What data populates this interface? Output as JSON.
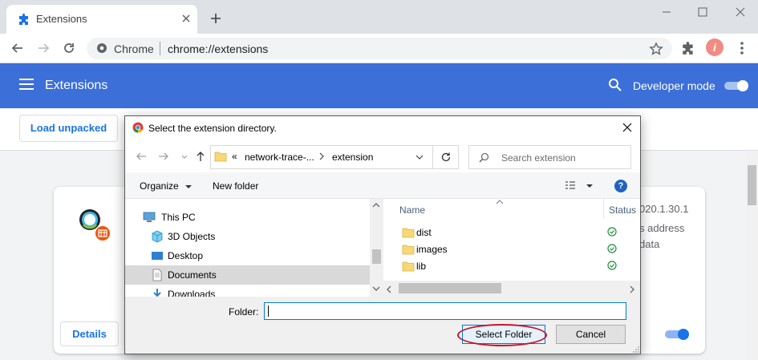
{
  "browser": {
    "tab_title": "Extensions",
    "omnibox": {
      "scheme_label": "Chrome",
      "url": "chrome://extensions"
    },
    "avatar_letter": "i"
  },
  "extensions_page": {
    "title": "Extensions",
    "developer_mode_label": "Developer mode",
    "developer_mode_on": true,
    "load_unpacked_label": "Load unpacked",
    "card": {
      "version_partial": "020.1.30.1",
      "desc_partial_1": "s address",
      "desc_partial_2": "data",
      "details_label": "Details",
      "enabled": true
    }
  },
  "dialog": {
    "title": "Select the extension directory.",
    "breadcrumb": {
      "overflow": "«",
      "segments": [
        "network-trace-...",
        "extension"
      ]
    },
    "search_placeholder": "Search extension",
    "commands": {
      "organize": "Organize",
      "new_folder": "New folder",
      "help": "?"
    },
    "tree": [
      {
        "label": "This PC",
        "icon": "this-pc-icon"
      },
      {
        "label": "3D Objects",
        "icon": "3d-objects-icon"
      },
      {
        "label": "Desktop",
        "icon": "desktop-icon"
      },
      {
        "label": "Documents",
        "icon": "documents-icon",
        "selected": true
      },
      {
        "label": "Downloads",
        "icon": "downloads-icon"
      }
    ],
    "columns": {
      "name": "Name",
      "status": "Status"
    },
    "files": [
      {
        "name": "dist",
        "status": "synced"
      },
      {
        "name": "images",
        "status": "synced"
      },
      {
        "name": "lib",
        "status": "synced"
      }
    ],
    "folder_label": "Folder:",
    "folder_value": "",
    "select_button": "Select Folder",
    "cancel_button": "Cancel"
  },
  "colors": {
    "accent_blue": "#3c6fd8",
    "link_blue": "#1a73e8",
    "highlight_red": "#c4152b",
    "status_green": "#1e8e3e"
  }
}
